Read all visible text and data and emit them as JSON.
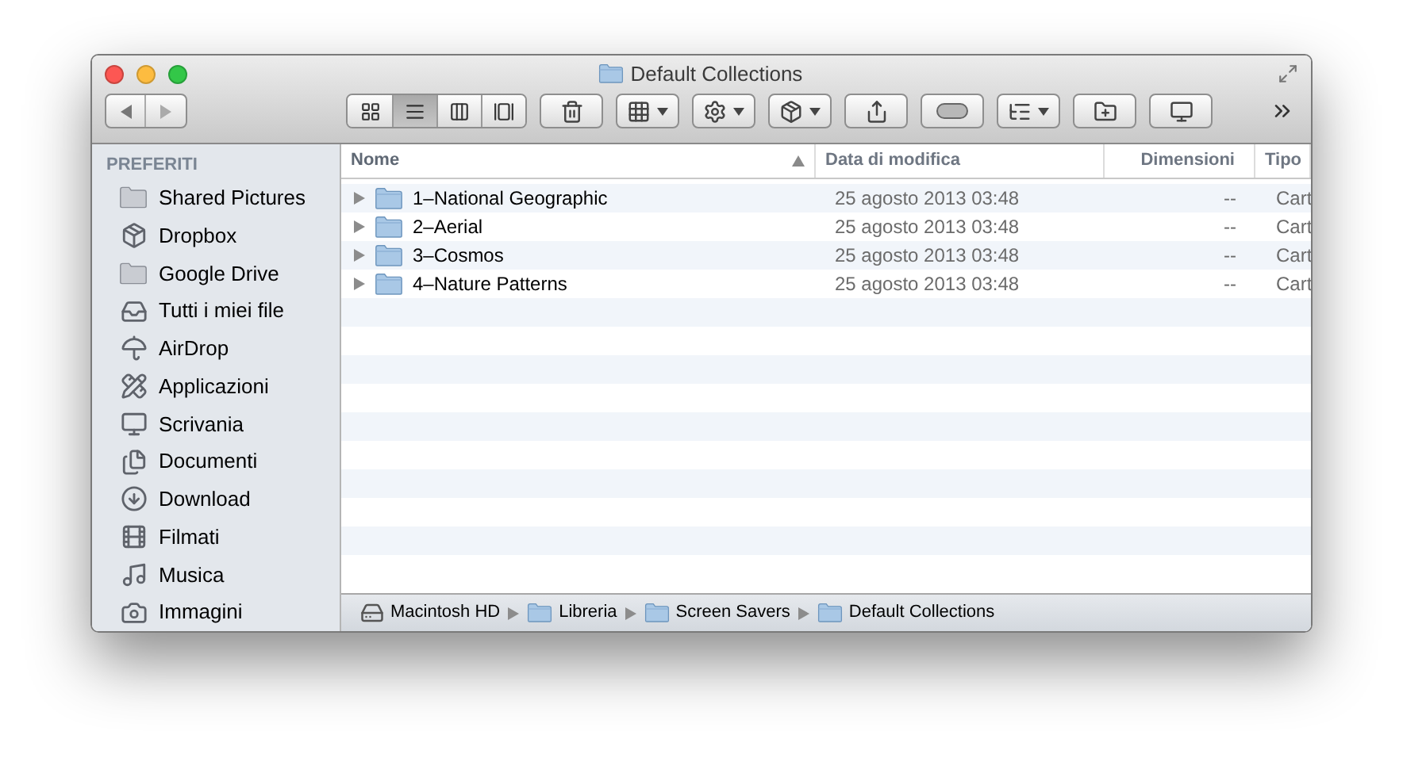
{
  "window": {
    "title": "Default Collections"
  },
  "toolbar": {
    "view_buttons": [
      {
        "kind": "icons",
        "selected": false
      },
      {
        "kind": "list",
        "selected": true
      },
      {
        "kind": "columns",
        "selected": false
      },
      {
        "kind": "coverflow",
        "selected": false
      }
    ],
    "buttons": [
      {
        "kind": "trash",
        "menu": false
      },
      {
        "kind": "arrange",
        "menu": true
      },
      {
        "kind": "action",
        "menu": true
      },
      {
        "kind": "dropbox",
        "menu": true
      },
      {
        "kind": "share",
        "menu": false
      },
      {
        "kind": "tag",
        "menu": false
      },
      {
        "kind": "outline",
        "menu": true
      },
      {
        "kind": "new-folder",
        "menu": false
      },
      {
        "kind": "connect",
        "menu": false
      }
    ]
  },
  "sidebar": {
    "heading": "PREFERITI",
    "items": [
      {
        "label": "Shared Pictures",
        "kind": "folder"
      },
      {
        "label": "Dropbox",
        "kind": "dropbox"
      },
      {
        "label": "Google Drive",
        "kind": "folder"
      },
      {
        "label": "Tutti i miei file",
        "kind": "allfiles"
      },
      {
        "label": "AirDrop",
        "kind": "airdrop"
      },
      {
        "label": "Applicazioni",
        "kind": "apps"
      },
      {
        "label": "Scrivania",
        "kind": "desktop"
      },
      {
        "label": "Documenti",
        "kind": "documents"
      },
      {
        "label": "Download",
        "kind": "download"
      },
      {
        "label": "Filmati",
        "kind": "movies"
      },
      {
        "label": "Musica",
        "kind": "music"
      },
      {
        "label": "Immagini",
        "kind": "pictures"
      }
    ]
  },
  "table": {
    "columns": [
      {
        "label": "Nome",
        "sorted": true
      },
      {
        "label": "Data di modifica",
        "sorted": false
      },
      {
        "label": "Dimensioni",
        "sorted": false
      },
      {
        "label": "Tipo",
        "sorted": false
      }
    ],
    "rows": [
      {
        "name": "1–National Geographic",
        "modified": "25 agosto 2013 03:48",
        "size": "--",
        "type": "Cart",
        "expanded": false
      },
      {
        "name": "2–Aerial",
        "modified": "25 agosto 2013 03:48",
        "size": "--",
        "type": "Cart",
        "expanded": false
      },
      {
        "name": "3–Cosmos",
        "modified": "25 agosto 2013 03:48",
        "size": "--",
        "type": "Cart",
        "expanded": false
      },
      {
        "name": "4–Nature Patterns",
        "modified": "25 agosto 2013 03:48",
        "size": "--",
        "type": "Cart",
        "expanded": false
      }
    ]
  },
  "path_bar": [
    {
      "label": "Macintosh HD",
      "kind": "disk"
    },
    {
      "label": "Libreria",
      "kind": "library"
    },
    {
      "label": "Screen Savers",
      "kind": "folder"
    },
    {
      "label": "Default Collections",
      "kind": "folder"
    }
  ]
}
